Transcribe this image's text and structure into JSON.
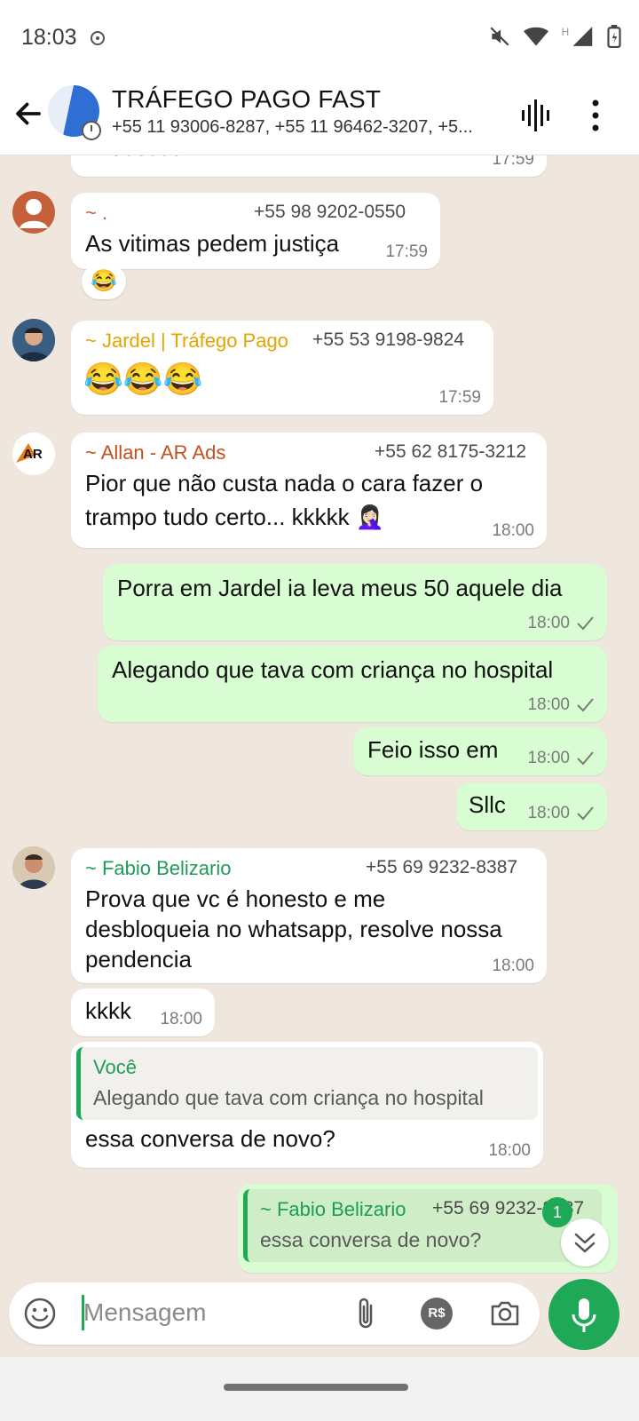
{
  "status_bar": {
    "time": "18:03"
  },
  "header": {
    "title": "TRÁFEGO PAGO FAST",
    "participants": "+55 11 93006-8287, +55 11 96462-3207, +5..."
  },
  "messages": [
    {
      "type": "in",
      "text": "Processo",
      "time": "17:59"
    },
    {
      "type": "in",
      "sender": "~ .",
      "phone": "+55 98 9202-0550",
      "text": "As vitimas pedem justiça",
      "time": "17:59",
      "reaction": "😂"
    },
    {
      "type": "in",
      "sender": "~ Jardel | Tráfego Pago",
      "phone": "+55 53 9198-9824",
      "text": "😂😂😂",
      "time": "17:59"
    },
    {
      "type": "in",
      "sender": "~ Allan - AR Ads",
      "phone": "+55 62 8175-3212",
      "line1": "Pior que não custa nada o cara fazer o",
      "line2": "trampo tudo certo... kkkkk 🤦🏻‍♀️",
      "time": "18:00"
    },
    {
      "type": "out",
      "text": "Porra em Jardel ia leva meus 50 aquele dia",
      "time": "18:00"
    },
    {
      "type": "out",
      "text": "Alegando que tava com criança no hospital",
      "time": "18:00"
    },
    {
      "type": "out",
      "text": "Feio isso em",
      "time": "18:00"
    },
    {
      "type": "out",
      "text": "Sllc",
      "time": "18:00"
    },
    {
      "type": "in",
      "sender": "~ Fabio Belizario",
      "phone": "+55 69 9232-8387",
      "line1": "Prova que vc é honesto e me",
      "line2": "desbloqueia no whatsapp, resolve nossa",
      "line3": "pendencia",
      "time": "18:00"
    },
    {
      "type": "in",
      "text": "kkkk",
      "time": "18:00"
    },
    {
      "type": "in",
      "quote_author": "Você",
      "quote_text": "Alegando que tava com criança no hospital",
      "text": "essa conversa de novo?",
      "time": "18:00"
    },
    {
      "type": "out",
      "quote_author": "~ Fabio Belizario",
      "quote_phone": "+55 69 9232-8387",
      "quote_text": "essa conversa de novo?"
    }
  ],
  "unread_badge": "1",
  "avatars": {
    "allan_logo": "AR"
  },
  "composer": {
    "placeholder": "Mensagem",
    "currency_icon": "R$"
  },
  "colors": {
    "accent": "#1fa855",
    "outgoing_bubble": "#d9fdd3",
    "chat_bg": "#efe7de",
    "sender_jardel": "#e3a400",
    "sender_allan": "#c4501f",
    "sender_fabio": "#1f9c5a"
  },
  "icons": [
    "back-arrow-icon",
    "voice-call-icon",
    "more-options-icon",
    "emoji-icon",
    "attach-icon",
    "payment-icon",
    "camera-icon",
    "mic-icon",
    "scroll-down-icon",
    "check-icon"
  ]
}
